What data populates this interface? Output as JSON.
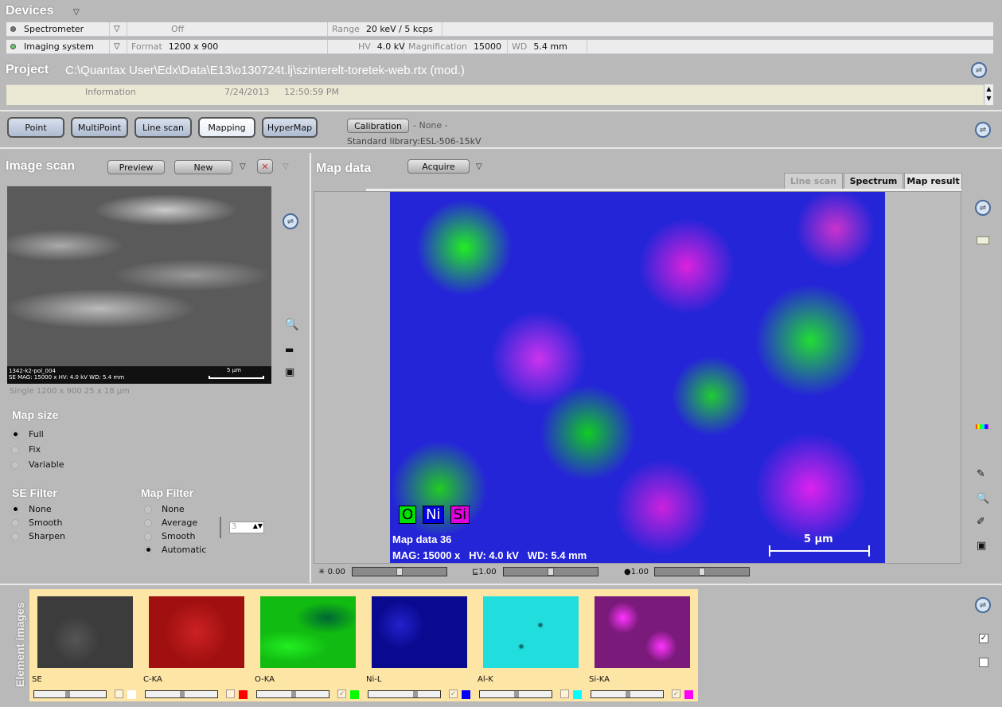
{
  "devices": {
    "title": "Devices",
    "spectrometer": {
      "name": "Spectrometer",
      "status": "Off",
      "range_label": "Range",
      "range": "20 keV / 5 kcps"
    },
    "imaging": {
      "name": "Imaging system",
      "format_label": "Format",
      "format": "1200 x 900",
      "hv_label": "HV",
      "hv": "4.0 kV",
      "mag_label": "Magnification",
      "mag": "15000",
      "wd_label": "WD",
      "wd": "5.4 mm"
    }
  },
  "project": {
    "title": "Project",
    "path": "C:\\Quantax User\\Edx\\Data\\E13\\o130724t.lj\\szinterelt-toretek-web.rtx  (mod.)",
    "info_label": "Information",
    "info_date": "7/24/2013",
    "info_time": "12:50:59 PM"
  },
  "modes": {
    "buttons": [
      "Point",
      "MultiPoint",
      "Line scan",
      "Mapping",
      "HyperMap"
    ],
    "selected": "Mapping",
    "calibration": "Calibration",
    "calibration_value": "- None -",
    "library": "Standard library:ESL-506-15kV"
  },
  "image_scan": {
    "title": "Image scan",
    "preview": "Preview",
    "new": "New",
    "overlay_name": "1342-k2-pol_004",
    "overlay_info": "SE  MAG: 15000 x   HV: 4.0 kV   WD: 5.4 mm",
    "scale": "5 µm",
    "info": "Single   1200 x 900   25 x 18 µm"
  },
  "map_size": {
    "title": "Map size",
    "options": [
      "Full",
      "Fix",
      "Variable"
    ],
    "selected": "Full"
  },
  "se_filter": {
    "title": "SE Filter",
    "options": [
      "None",
      "Smooth",
      "Sharpen"
    ],
    "selected": "None"
  },
  "map_filter": {
    "title": "Map Filter",
    "options": [
      "None",
      "Average",
      "Smooth",
      "Automatic"
    ],
    "selected": "Automatic",
    "level": "3"
  },
  "map_data": {
    "title": "Map data",
    "acquire": "Acquire",
    "tabs": [
      "Line scan",
      "Spectrum",
      "Map result"
    ],
    "active_tab": "Map result",
    "legend": [
      {
        "el": "O",
        "color": "#00e000"
      },
      {
        "el": "Ni",
        "color": "#0000e0"
      },
      {
        "el": "Si",
        "color": "#e000e0"
      }
    ],
    "name": "Map data 36",
    "info": "MAG: 15000 x   HV: 4.0 kV   WD: 5.4 mm",
    "scale": "5 µm",
    "sliders": [
      {
        "label": "0.00",
        "value": 0.5
      },
      {
        "label": "1.00",
        "value": 0.5
      },
      {
        "label": "1.00",
        "value": 0.5
      }
    ]
  },
  "element_images": {
    "title": "Element images",
    "items": [
      {
        "label": "SE",
        "color": "#ffffff",
        "checked": false,
        "slider": 0.45
      },
      {
        "label": "C-KA",
        "color": "#ff0000",
        "checked": false,
        "slider": 0.5
      },
      {
        "label": "O-KA",
        "color": "#00ff00",
        "checked": true,
        "slider": 0.5
      },
      {
        "label": "Ni-L",
        "color": "#0000ff",
        "checked": true,
        "slider": 0.65
      },
      {
        "label": "Al-K",
        "color": "#00ffff",
        "checked": false,
        "slider": 0.5
      },
      {
        "label": "Si-KA",
        "color": "#ff00ff",
        "checked": true,
        "slider": 0.5
      }
    ]
  }
}
